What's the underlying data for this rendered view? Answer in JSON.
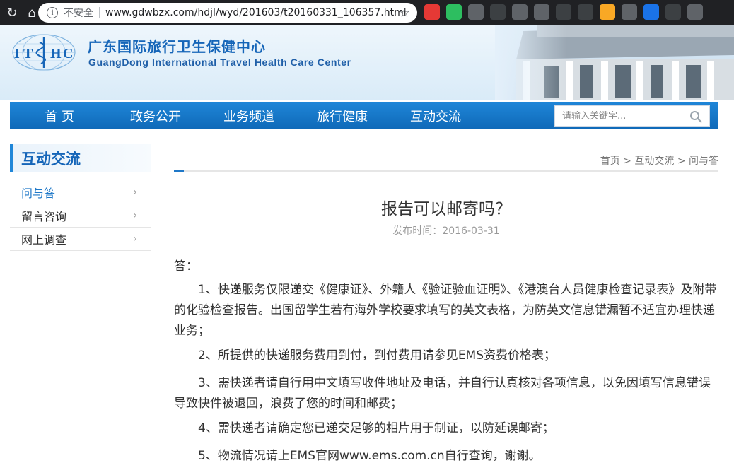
{
  "browser": {
    "security_label": "不安全",
    "url": "www.gdwbzx.com/hdjl/wyd/201603/t20160331_106357.html",
    "extension_icons": [
      {
        "name": "pdf-extension-icon",
        "color": "#e53935"
      },
      {
        "name": "evernote-extension-icon",
        "color": "#2dbe60"
      },
      {
        "name": "image-extension-icon",
        "color": "#5f6368"
      },
      {
        "name": "eye-extension-icon",
        "color": "#3c4043"
      },
      {
        "name": "grid-extension-icon",
        "color": "#5f6368"
      },
      {
        "name": "rss-extension-icon",
        "color": "#5f6368"
      },
      {
        "name": "circle-extension-icon",
        "color": "#3c4043"
      },
      {
        "name": "timer-extension-icon",
        "color": "#3c4043"
      },
      {
        "name": "pen-extension-icon",
        "color": "#f9a825"
      },
      {
        "name": "shield-extension-icon",
        "color": "#5f6368"
      },
      {
        "name": "edit-extension-icon",
        "color": "#1a73e8"
      },
      {
        "name": "trash-extension-icon",
        "color": "#3c4043"
      },
      {
        "name": "chat-extension-icon",
        "color": "#5f6368"
      }
    ]
  },
  "site": {
    "logo_text": "IT HC",
    "title": "广东国际旅行卫生保健中心",
    "subtitle": "GuangDong International Travel Health Care Center"
  },
  "nav": {
    "items": [
      "首 页",
      "政务公开",
      "业务频道",
      "旅行健康",
      "互动交流"
    ],
    "search_placeholder": "请输入关键字..."
  },
  "sidebar": {
    "title": "互动交流",
    "items": [
      {
        "label": "问与答",
        "active": true
      },
      {
        "label": "留言咨询",
        "active": false
      },
      {
        "label": "网上调查",
        "active": false
      }
    ]
  },
  "breadcrumb": [
    "首页",
    "互动交流",
    "问与答"
  ],
  "article": {
    "title": "报告可以邮寄吗？",
    "date_label": "发布时间：2016-03-31",
    "answer_prefix": "答：",
    "paragraphs": [
      "1、快递服务仅限递交《健康证》、外籍人《验证验血证明》、《港澳台人员健康检查记录表》及附带的化验检查报告。出国留学生若有海外学校要求填写的英文表格，为防英文信息错漏暂不适宜办理快递业务；",
      "2、所提供的快递服务费用到付，到付费用请参见EMS资费价格表；",
      "3、需快递者请自行用中文填写收件地址及电话，并自行认真核对各项信息，以免因填写信息错误导致快件被退回，浪费了您的时间和邮费；",
      "4、需快递者请确定您已递交足够的相片用于制证，以防延误邮寄；",
      "5、物流情况请上EMS官网www.ems.com.cn自行查询，谢谢。"
    ]
  },
  "colors": {
    "brand_blue": "#1565b8",
    "nav_blue": "#1f86d8",
    "active_link": "#1f78c8"
  }
}
